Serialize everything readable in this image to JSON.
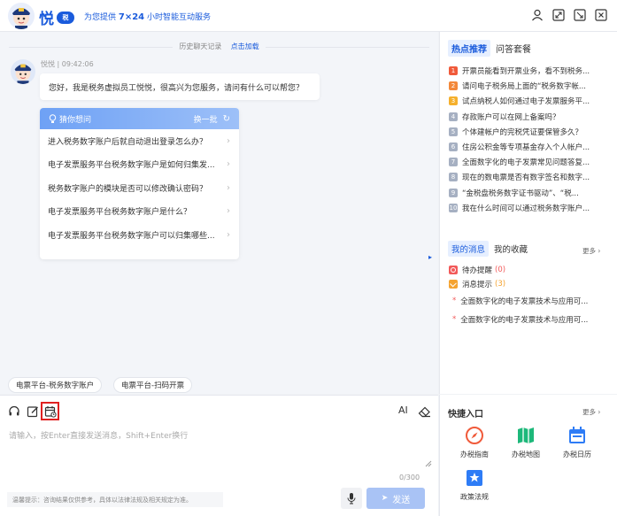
{
  "header": {
    "brand": "悦",
    "brand_badge": "税",
    "slogan_prefix": "为您提供",
    "slogan_bold": "7×24",
    "slogan_suffix": "小时智能互动服务"
  },
  "chat": {
    "history_text": "历史聊天记录",
    "history_link": "点击加载",
    "sender": "悦悦 | 09:42:06",
    "greeting": "您好，我是税务虚拟员工悦悦，很高兴为您服务，请问有什么可以帮您？",
    "guess_title": "猜你想问",
    "guess_refresh": "换一批",
    "guess_items": [
      "进入税务数字账户后就自动退出登录怎么办？",
      "电子发票服务平台税务数字账户是如何归集发...",
      "税务数字账户的模块是否可以修改确认密码？",
      "电子发票服务平台税务数字账户是什么？",
      "电子发票服务平台税务数字账户可以归集哪些..."
    ],
    "chips": [
      "电票平台-税务数字账户",
      "电票平台-扫码开票"
    ]
  },
  "input": {
    "placeholder": "请输入，按Enter直接发送消息，Shift+Enter换行",
    "counter": "0/300",
    "tip": "温馨提示：咨询结果仅供参考，具体以法律法规及相关规定为准。",
    "send": "发送",
    "ai_label": "AI"
  },
  "hot": {
    "tab_active": "热点推荐",
    "tab_other": "问答套餐",
    "items": [
      {
        "n": "1",
        "text": "开票员能看到开票业务，看不到税务...",
        "color": "#f05a3a"
      },
      {
        "n": "2",
        "text": "请问电子税务局上面的“税务数字帐...",
        "color": "#f3883a"
      },
      {
        "n": "3",
        "text": "试点纳税人如何通过电子发票服务平...",
        "color": "#f5b02c"
      },
      {
        "n": "4",
        "text": "存款账户可以在网上备案吗？",
        "color": "#a6b0c2"
      },
      {
        "n": "5",
        "text": "个体建帐户的完税凭证要保管多久？",
        "color": "#a6b0c2"
      },
      {
        "n": "6",
        "text": "住房公积金等专项基金存入个人帐户...",
        "color": "#a6b0c2"
      },
      {
        "n": "7",
        "text": "全面数字化的电子发票常见问题答复...",
        "color": "#a6b0c2"
      },
      {
        "n": "8",
        "text": "现在的数电票是否有数字签名和数字...",
        "color": "#a6b0c2"
      },
      {
        "n": "9",
        "text": "“金税盘税务数字证书驱动”、“税...",
        "color": "#a6b0c2"
      },
      {
        "n": "10",
        "text": "我在什么时间可以通过税务数字账户...",
        "color": "#a6b0c2"
      }
    ]
  },
  "messages": {
    "tab_active": "我的消息",
    "tab_other": "我的收藏",
    "more": "更多",
    "pending_label": "待办提醒",
    "pending_count": "(0)",
    "notice_label": "消息提示",
    "notice_count": "(3)",
    "items": [
      "全面数字化的电子发票技术与应用可...",
      "全面数字化的电子发票技术与应用可..."
    ]
  },
  "quick": {
    "title": "快捷入口",
    "more": "更多",
    "items": [
      "办税指南",
      "办税地图",
      "办税日历",
      "政策法规"
    ]
  },
  "colors": {
    "accent": "#1a5bdc",
    "red": "#e02020",
    "green": "#1db87a"
  }
}
